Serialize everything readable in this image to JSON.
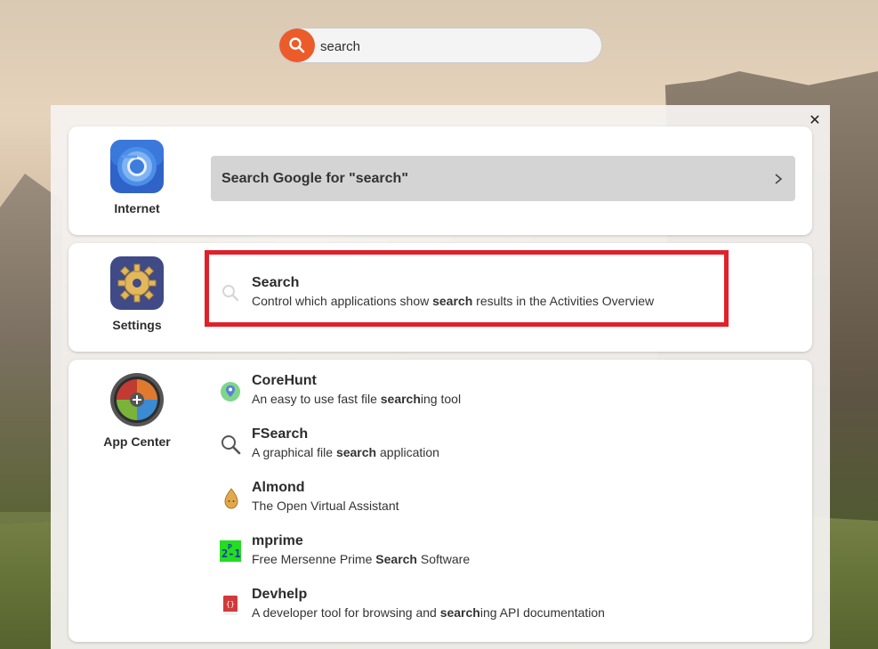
{
  "search": {
    "value": "search",
    "icon": "search-icon",
    "accent": "#ec5b2a"
  },
  "close": {
    "glyph": "✕",
    "icon": "close-icon"
  },
  "internet": {
    "label": "Internet",
    "icon": "chromium-icon",
    "action_label": "Search Google for \"search\"",
    "action_icon": "chevron-right-icon"
  },
  "settings": {
    "label": "Settings",
    "icon": "gear-icon",
    "result": {
      "title": "Search",
      "desc_before": "Control which applications show ",
      "desc_bold": "search",
      "desc_after": " results in the Activities Overview",
      "icon": "search-icon"
    },
    "highlight_color": "#e0202a"
  },
  "app_center": {
    "label": "App Center",
    "icon": "app-center-icon",
    "results": [
      {
        "title": "CoreHunt",
        "desc_before": "An easy to use fast file ",
        "desc_bold": "search",
        "desc_after": "ing tool",
        "icon": "location-pin-icon"
      },
      {
        "title": "FSearch",
        "desc_before": "A graphical file ",
        "desc_bold": "search",
        "desc_after": " application",
        "icon": "magnifier-icon"
      },
      {
        "title": "Almond",
        "desc_before": "The Open Virtual Assistant",
        "desc_bold": "",
        "desc_after": "",
        "icon": "almond-icon"
      },
      {
        "title": "mprime",
        "desc_before": "Free Mersenne Prime ",
        "desc_bold": "Search",
        "desc_after": " Software",
        "icon": "mprime-icon"
      },
      {
        "title": "Devhelp",
        "desc_before": "A developer tool for browsing and ",
        "desc_bold": "search",
        "desc_after": "ing API documentation",
        "icon": "book-icon"
      }
    ]
  }
}
